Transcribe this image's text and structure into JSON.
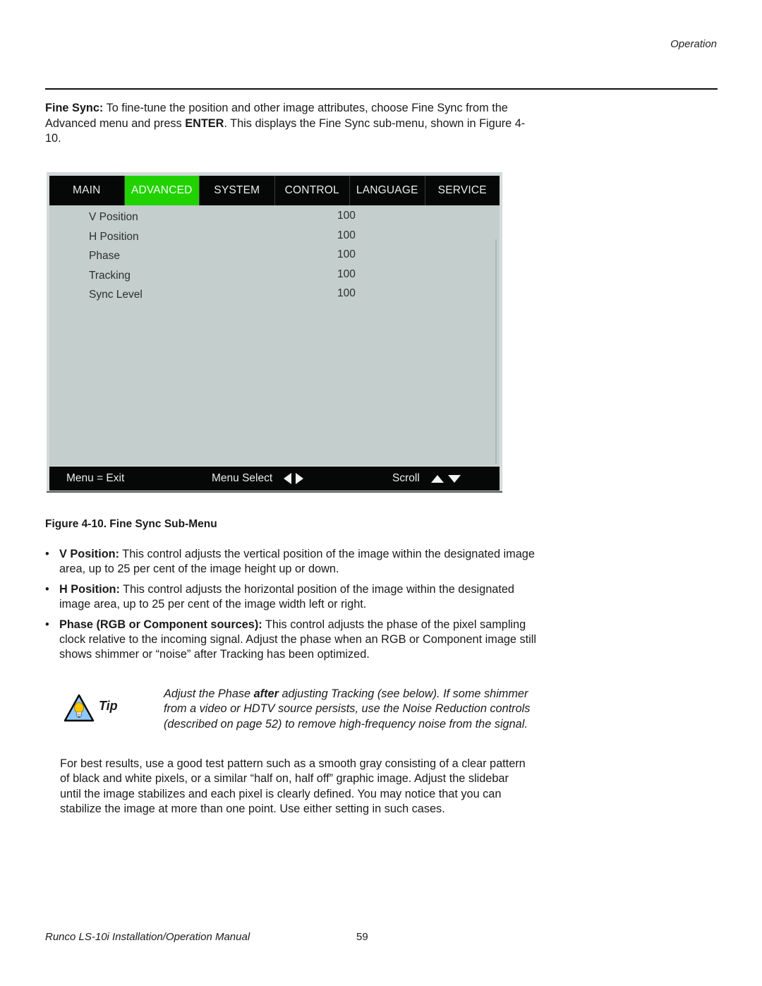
{
  "header": {
    "section": "Operation"
  },
  "intro": {
    "term": "Fine Sync:",
    "text_1": " To fine-tune the position and other image attributes, choose Fine Sync from the Advanced menu and press ",
    "key": "ENTER",
    "text_2": ". This displays the Fine Sync sub-menu, shown in Figure 4-10."
  },
  "osd_menu": {
    "tabs": [
      {
        "label": "MAIN",
        "active": false
      },
      {
        "label": "ADVANCED",
        "active": true
      },
      {
        "label": "SYSTEM",
        "active": false
      },
      {
        "label": "CONTROL",
        "active": false
      },
      {
        "label": "LANGUAGE",
        "active": false
      },
      {
        "label": "SERVICE",
        "active": false
      }
    ],
    "items": [
      {
        "label": "V Position",
        "value": "100"
      },
      {
        "label": "H Position",
        "value": "100"
      },
      {
        "label": "Phase",
        "value": "100"
      },
      {
        "label": "Tracking",
        "value": "100"
      },
      {
        "label": "Sync Level",
        "value": "100"
      }
    ],
    "footer": {
      "exit": "Menu = Exit",
      "select": "Menu Select",
      "scroll": "Scroll"
    },
    "colors": {
      "active_tab": "#22d200",
      "bar": "#060807",
      "panel": "#c4cecc"
    }
  },
  "caption": "Figure 4-10. Fine Sync Sub-Menu",
  "bullets": [
    {
      "term": "V Position:",
      "text": " This control adjusts the vertical position of the image within the designated image area, up to 25 per cent of the image height up or down."
    },
    {
      "term": "H Position:",
      "text": " This control adjusts the horizontal position of the image within the designated image area, up to 25 per cent of the image width left or right."
    },
    {
      "term": "Phase (RGB or Component sources):",
      "text": " This control adjusts the phase of the pixel sampling clock relative to the incoming signal. Adjust the phase when an RGB or Component image still shows shimmer or “noise” after Tracking has been optimized."
    }
  ],
  "tip": {
    "label": "Tip",
    "text_1": "Adjust the Phase ",
    "emphasis": "after",
    "text_2": " adjusting Tracking (see below). If some shimmer from a video or HDTV source persists, use the Noise Reduction controls (described on page 52) to remove high-frequency noise from the signal."
  },
  "paragraph": "For best results, use a good test pattern such as a smooth gray consisting of a clear pattern of black and white pixels, or a similar “half on, half off” graphic image. Adjust the slidebar until the image stabilizes and each pixel is clearly defined. You may notice that you can stabilize the image at more than one point. Use either setting in such cases.",
  "footer": {
    "manual_title": "Runco LS-10i Installation/Operation Manual",
    "page_number": "59"
  }
}
